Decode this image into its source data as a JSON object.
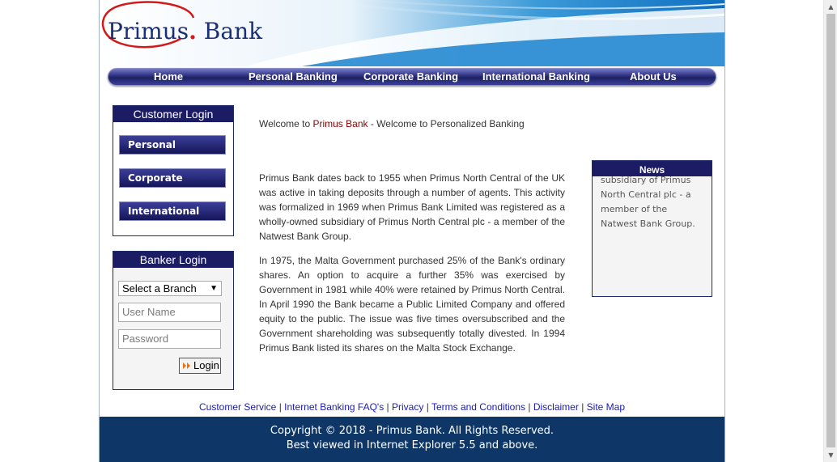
{
  "logo": {
    "name": "Primus",
    "dot": ".",
    "suffix": "Bank"
  },
  "nav": {
    "items": [
      "Home",
      "Personal Banking",
      "Corporate Banking",
      "International Banking",
      "About Us"
    ]
  },
  "customer_login": {
    "title": "Customer Login",
    "buttons": [
      "Personal",
      "Corporate",
      "International"
    ]
  },
  "banker_login": {
    "title": "Banker Login",
    "branch_select": "Select a Branch",
    "username_placeholder": "User Name",
    "password_placeholder": "Password",
    "submit_label": "Login"
  },
  "welcome": {
    "prefix": "Welcome to ",
    "brand": "Primus Bank",
    "suffix": " - Welcome to Personalized Banking"
  },
  "content": {
    "paragraph1": "Primus Bank dates back to 1955 when Primus North Central of the UK was active in taking deposits through a number of agents. This activity was formalized in 1969 when Primus Bank Limited was registered as a wholly-owned subsidiary of Primus North Central plc - a member of the Natwest Bank Group.",
    "paragraph2": "In 1975, the Malta Government purchased 25% of the Bank's ordinary shares. An option to acquire a further 35% was exercised by Government in 1981 while 40% were retained by Primus North Central. In April 1990 the Bank became a Public Limited Company and offered equity to the public. The issue was five times oversubscribed and the Government shareholding was subsequently totally divested. In 1994 Primus Bank listed its shares on the Malta Stock Exchange."
  },
  "news": {
    "title": "News",
    "text": "subsidiary of Primus North Central plc - a member of the Natwest Bank Group."
  },
  "footer": {
    "links": [
      "Customer Service",
      "Internet Banking FAQ's",
      "Privacy",
      "Terms and Conditions",
      "Disclaimer",
      "Site Map"
    ],
    "separator": "|",
    "copyright": "Copyright © 2018 - Primus Bank. All Rights Reserved.",
    "browser_note": "Best viewed in Internet Explorer 5.5 and above."
  },
  "colors": {
    "navy": "#1c1c64",
    "footer_bg": "#0e3767",
    "logo_red": "#d21a1a",
    "link": "#1a1ab6",
    "brand_text": "#8b0000"
  }
}
